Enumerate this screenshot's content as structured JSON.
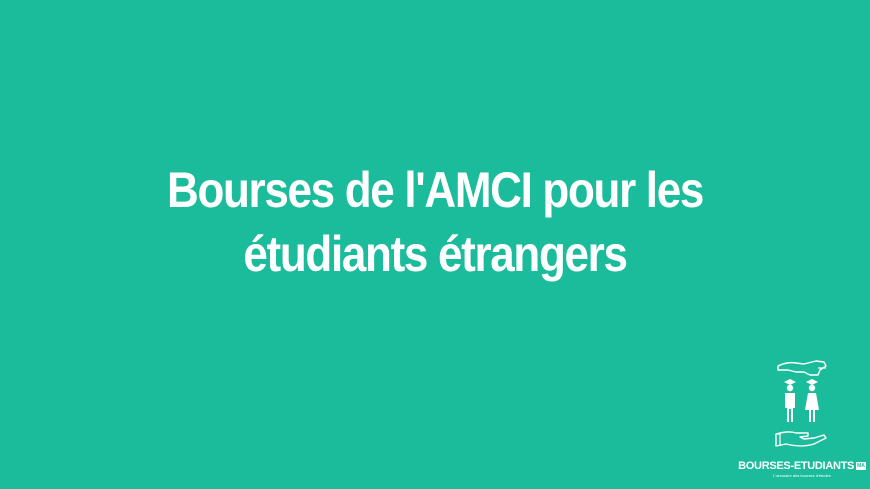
{
  "background_color": "#1bbc9b",
  "text_color": "#ffffff",
  "headline": {
    "line1": "Bourses de l'AMCI pour les",
    "line2": "étudiants étrangers"
  },
  "logo": {
    "icon": "hands-holding-graduates-icon",
    "wordmark": "BOURSES-ETUDIANTS",
    "badge": "MA",
    "tagline": "L'annuaire des bourses d'études"
  }
}
